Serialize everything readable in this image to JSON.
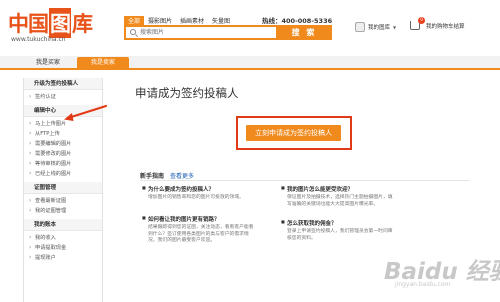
{
  "header": {
    "logo_text_a": "中国",
    "logo_text_b": "图",
    "logo_text_c": "库",
    "logo_url": "www.tukuchina.cn",
    "search_tabs": [
      "全部",
      "摄影图片",
      "插画素材",
      "矢量图"
    ],
    "hotline": "热线：400-008-5336",
    "search_placeholder": "搜索图片",
    "search_button": "搜 索",
    "account_label": "我的图库",
    "cart_count": "0",
    "cart_label": "我的购物车结算"
  },
  "nav": {
    "buyer_tab": "我是买家",
    "seller_tab": "我是卖家"
  },
  "sidebar": {
    "sections": [
      {
        "title": "升级为签约投稿人",
        "items": [
          "签约认证"
        ]
      },
      {
        "title": "编辑中心",
        "items": [
          "马上上传图片",
          "从FTP上传",
          "需要编辑的图片",
          "需要修改的图片",
          "等待审核的图片",
          "已经上线的图片"
        ]
      },
      {
        "title": "证图管理",
        "items": [
          "查看最新证图",
          "我的证图管理"
        ]
      },
      {
        "title": "我的账本",
        "items": [
          "我的收入",
          "申请提取现金",
          "提现账户"
        ]
      }
    ]
  },
  "main": {
    "title": "申请成为签约投稿人",
    "cta_button": "立刻申请成为签约投稿人",
    "guide_title": "新手指南",
    "guide_more": "查看更多",
    "faqs": [
      {
        "q": "为什么要成为签约投稿人？",
        "a": "增加图片的销售率和您的图片可投放的领域。"
      },
      {
        "q": "如何看让我的图片更有销路？",
        "a": "结果跟踪得到您的证图，关注动态，看看客户能看到什么？签订使用各类图片的类与客户的需求情况，我们的图片最受客户欢迎。"
      },
      {
        "q": "我的图片怎么能更受欢迎？",
        "a": "保证图片及拍摄技术，选择热门主题拍摄图片，填写准确的关键词也能大大提高图片曝光率。"
      },
      {
        "q": "怎么获取我的佣金？",
        "a": "登录上申请签约投稿人，我们管理员会第一时间审核您的资料。"
      }
    ]
  },
  "watermark": {
    "text": "Baidu 经验",
    "sub": "jingyan.baidu.com"
  },
  "colors": {
    "accent": "#f08a1c",
    "highlight_border": "#e23a16",
    "link": "#1a5cb3"
  }
}
